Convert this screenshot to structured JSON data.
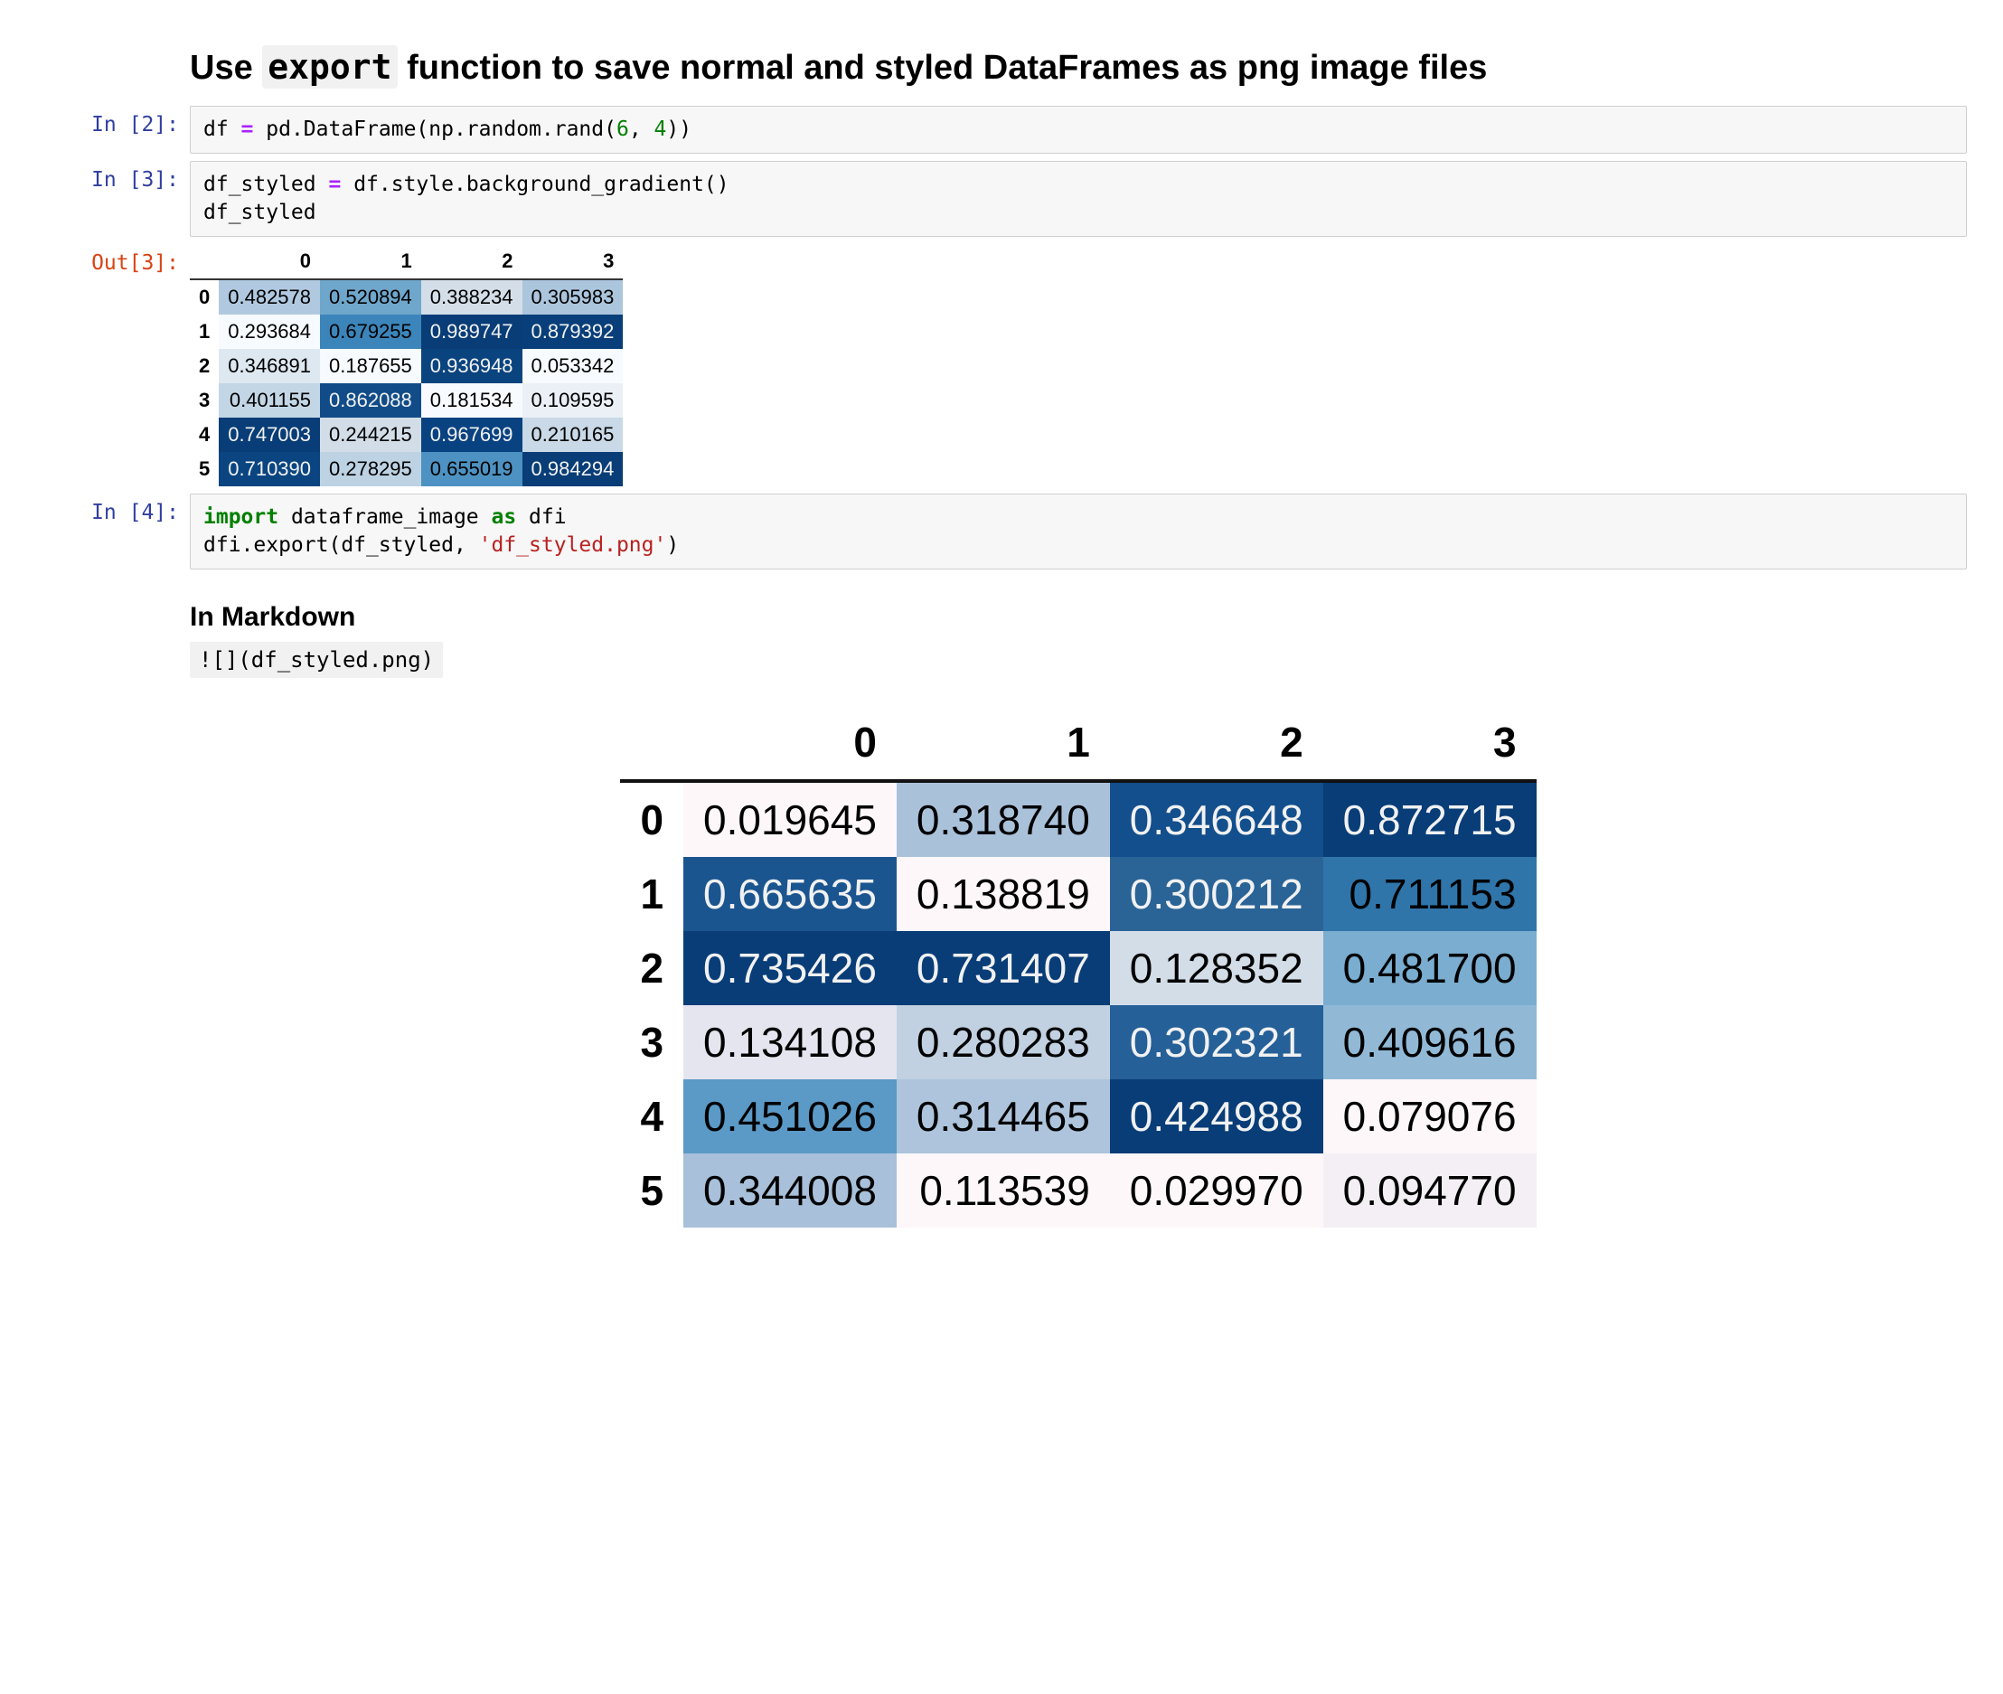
{
  "title": {
    "pre": "Use ",
    "code": "export",
    "post": " function to save normal and styled DataFrames as png image files"
  },
  "cells": {
    "c2": {
      "prompt": "In [2]:",
      "code_parts": [
        "df ",
        "=",
        " pd.DataFrame(np.random.rand(",
        "6",
        ", ",
        "4",
        "))"
      ]
    },
    "c3": {
      "prompt_in": "In [3]:",
      "code_parts_l1": [
        "df_styled ",
        "=",
        " df.style.background_gradient()"
      ],
      "code_l2": "df_styled",
      "prompt_out": "Out[3]:"
    },
    "c4": {
      "prompt": "In [4]:",
      "code_parts_l1": [
        "import",
        " dataframe_image ",
        "as",
        " dfi"
      ],
      "code_parts_l2": [
        "dfi.export(df_styled, ",
        "'df_styled.png'",
        ")"
      ]
    }
  },
  "df_small": {
    "cols": [
      "0",
      "1",
      "2",
      "3"
    ],
    "idx": [
      "0",
      "1",
      "2",
      "3",
      "4",
      "5"
    ],
    "rows": [
      [
        "0.482578",
        "0.520894",
        "0.388234",
        "0.305983"
      ],
      [
        "0.293684",
        "0.679255",
        "0.989747",
        "0.879392"
      ],
      [
        "0.346891",
        "0.187655",
        "0.936948",
        "0.053342"
      ],
      [
        "0.401155",
        "0.862088",
        "0.181534",
        "0.109595"
      ],
      [
        "0.747003",
        "0.244215",
        "0.967699",
        "0.210165"
      ],
      [
        "0.710390",
        "0.278295",
        "0.655019",
        "0.984294"
      ]
    ],
    "bg": [
      [
        "#b0c9e0",
        "#6fa6cb",
        "#d4dee9",
        "#abc5dd"
      ],
      [
        "#f7fbff",
        "#3b85ba",
        "#083d77",
        "#083f7a"
      ],
      [
        "#dee8f1",
        "#f7fbff",
        "#0a447f",
        "#f7fbff"
      ],
      [
        "#c3d6e6",
        "#114c88",
        "#f7fbff",
        "#eaf0f6"
      ],
      [
        "#083d77",
        "#d2dde8",
        "#094280",
        "#c9d9e7"
      ],
      [
        "#0a4581",
        "#bdd2e3",
        "#4d92c2",
        "#083d77"
      ]
    ],
    "fg": [
      [
        "#000",
        "#000",
        "#000",
        "#000"
      ],
      [
        "#000",
        "#000",
        "#f1f1f1",
        "#f1f1f1"
      ],
      [
        "#000",
        "#000",
        "#f1f1f1",
        "#000"
      ],
      [
        "#000",
        "#f1f1f1",
        "#000",
        "#000"
      ],
      [
        "#f1f1f1",
        "#000",
        "#f1f1f1",
        "#000"
      ],
      [
        "#f1f1f1",
        "#000",
        "#000",
        "#f1f1f1"
      ]
    ]
  },
  "markdown": {
    "heading": "In Markdown",
    "code": "![](df_styled.png)"
  },
  "df_large": {
    "cols": [
      "0",
      "1",
      "2",
      "3"
    ],
    "idx": [
      "0",
      "1",
      "2",
      "3",
      "4",
      "5"
    ],
    "rows": [
      [
        "0.019645",
        "0.318740",
        "0.346648",
        "0.872715"
      ],
      [
        "0.665635",
        "0.138819",
        "0.300212",
        "0.711153"
      ],
      [
        "0.735426",
        "0.731407",
        "0.128352",
        "0.481700"
      ],
      [
        "0.134108",
        "0.280283",
        "0.302321",
        "0.409616"
      ],
      [
        "0.451026",
        "0.314465",
        "0.424988",
        "0.079076"
      ],
      [
        "0.344008",
        "0.113539",
        "0.029970",
        "0.094770"
      ]
    ],
    "bg": [
      [
        "#fdf7fa",
        "#aac1da",
        "#134f8c",
        "#083d77"
      ],
      [
        "#1b5590",
        "#fdf7fa",
        "#2a6497",
        "#2f75aa"
      ],
      [
        "#083d77",
        "#083d77",
        "#d3dde7",
        "#7aadcf"
      ],
      [
        "#e5e5ef",
        "#c1d1e2",
        "#256098",
        "#91b9d6"
      ],
      [
        "#5b99c6",
        "#adc4dc",
        "#083d77",
        "#fdf7fa"
      ],
      [
        "#a8c0d9",
        "#fdf7fa",
        "#fdf7fa",
        "#f3eff4"
      ]
    ],
    "fg": [
      [
        "#000",
        "#000",
        "#f1f1f1",
        "#f1f1f1"
      ],
      [
        "#f1f1f1",
        "#000",
        "#f1f1f1",
        "#000"
      ],
      [
        "#f1f1f1",
        "#f1f1f1",
        "#000",
        "#000"
      ],
      [
        "#000",
        "#000",
        "#f1f1f1",
        "#000"
      ],
      [
        "#000",
        "#000",
        "#f1f1f1",
        "#000"
      ],
      [
        "#000",
        "#000",
        "#000",
        "#000"
      ]
    ]
  }
}
